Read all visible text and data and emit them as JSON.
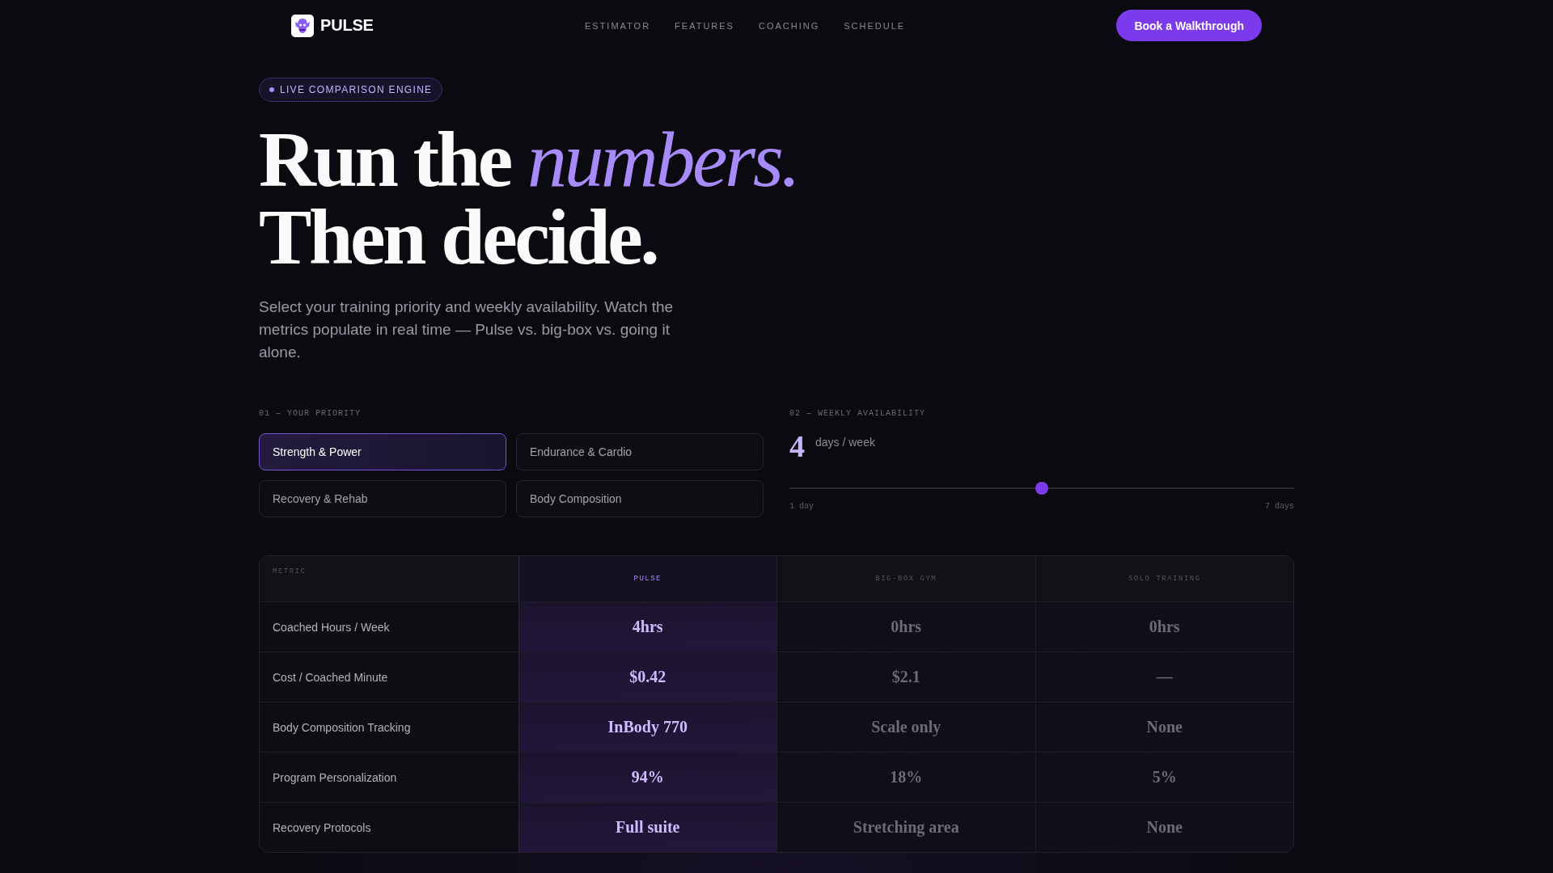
{
  "nav": {
    "brand": "PULSE",
    "links": [
      "ESTIMATOR",
      "FEATURES",
      "COACHING",
      "SCHEDULE"
    ],
    "cta": "Book a Walkthrough"
  },
  "hero": {
    "badge": "LIVE COMPARISON ENGINE",
    "heading_lines": [
      "Run the *numbers.*",
      "Then decide."
    ],
    "intro": "Select your training priority and weekly availability. Watch the metrics populate in real time — Pulse vs. big-box vs. going it alone."
  },
  "priority": {
    "label": "01 — YOUR PRIORITY",
    "options": [
      {
        "label": "Strength & Power",
        "selected": true
      },
      {
        "label": "Endurance & Cardio",
        "selected": false
      },
      {
        "label": "Recovery & Rehab",
        "selected": false
      },
      {
        "label": "Body Composition",
        "selected": false
      }
    ]
  },
  "availability": {
    "label": "02 — WEEKLY AVAILABILITY",
    "value": "4",
    "unit": "days / week",
    "level": 0.5,
    "min_label": "1 day",
    "max_label": "7 days"
  },
  "comparison": {
    "columns": [
      {
        "label": "METRIC",
        "highlighted": false
      },
      {
        "label": "PULSE",
        "highlighted": true
      },
      {
        "label": "BIG-BOX GYM",
        "highlighted": false
      },
      {
        "label": "SOLO TRAINING",
        "highlighted": false
      }
    ],
    "rows": [
      {
        "metric": "Coached Hours / Week",
        "values": [
          "4hrs",
          "0hrs",
          "0hrs"
        ]
      },
      {
        "metric": "Cost / Coached Minute",
        "values": [
          "$0.42",
          "$2.1",
          "—"
        ]
      },
      {
        "metric": "Body Composition Tracking",
        "values": [
          "InBody 770",
          "Scale only",
          "None"
        ]
      },
      {
        "metric": "Program Personalization",
        "values": [
          "94%",
          "18%",
          "5%"
        ]
      },
      {
        "metric": "Recovery Protocols",
        "values": [
          "Full suite",
          "Stretching area",
          "None"
        ]
      }
    ]
  }
}
